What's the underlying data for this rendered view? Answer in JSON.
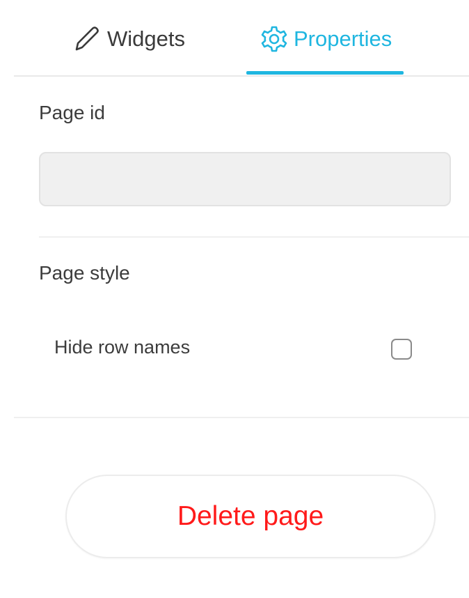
{
  "tabs": {
    "widgets": {
      "label": "Widgets",
      "icon": "pencil-icon"
    },
    "properties": {
      "label": "Properties",
      "icon": "gear-icon",
      "active": true
    }
  },
  "properties": {
    "page_id": {
      "label": "Page id",
      "value": "",
      "placeholder": ""
    },
    "page_style": {
      "label": "Page style",
      "hide_row_names": {
        "label": "Hide row names",
        "checked": false
      }
    },
    "delete_button": {
      "label": "Delete page"
    }
  },
  "colors": {
    "accent": "#1fb6e0",
    "danger": "#ff1a1a",
    "text": "#3c3c3c",
    "input_bg": "#f0f0f0"
  }
}
